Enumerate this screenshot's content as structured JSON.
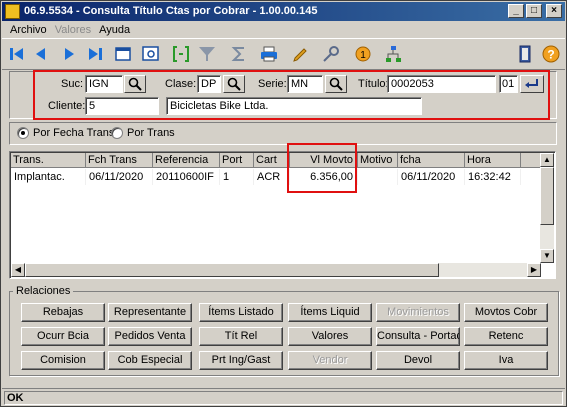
{
  "window": {
    "title": "06.9.5534 - Consulta Título Ctas por Cobrar - 1.00.00.145"
  },
  "menu": [
    {
      "label": "Archivo",
      "enabled": true
    },
    {
      "label": "Valores",
      "enabled": false
    },
    {
      "label": "Ayuda",
      "enabled": true
    }
  ],
  "toolbar": {
    "icons": [
      "first-icon",
      "prev-icon",
      "next-icon",
      "last-icon",
      "window-icon",
      "brackets-icon",
      "filter-icon",
      "sigma-icon",
      "print-icon",
      "pencil-icon",
      "key-icon",
      "alert-icon",
      "tree-icon",
      "exit-door-icon",
      "help-icon"
    ],
    "help_label": "?"
  },
  "search": {
    "suc_label": "Suc:",
    "suc_value": "IGN",
    "clase_label": "Clase:",
    "clase_value": "DP",
    "serie_label": "Serie:",
    "serie_value": "MN",
    "titulo_label": "Título:",
    "titulo_value": "0002053",
    "cuota_value": "01",
    "cliente_label": "Cliente:",
    "cliente_value": "5",
    "cliente_name": "Bicicletas Bike Ltda."
  },
  "view_mode": {
    "options": [
      "Por Fecha Trans",
      "Por Trans"
    ],
    "selected": "Por Fecha Trans"
  },
  "grid": {
    "columns": [
      "Trans.",
      "Fch Trans",
      "Referencia",
      "Port",
      "Cart",
      "Vl Movto",
      "Motivo",
      "fcha",
      "Hora"
    ],
    "rows": [
      [
        "Implantac.",
        "06/11/2020",
        "20110600IF",
        "1",
        "ACR",
        "6.356,00",
        "",
        "06/11/2020",
        "16:32:42"
      ]
    ]
  },
  "relaciones": {
    "title": "Relaciones",
    "buttons": [
      {
        "label": "Rebajas",
        "enabled": true
      },
      {
        "label": "Representante",
        "enabled": true
      },
      {
        "label": "Ítems Listado",
        "enabled": true
      },
      {
        "label": "Ítems Liquid",
        "enabled": true
      },
      {
        "label": "Movimientos",
        "enabled": false
      },
      {
        "label": "Movtos Cobr",
        "enabled": true
      },
      {
        "label": "Ocurr Bcia",
        "enabled": true
      },
      {
        "label": "Pedidos Venta",
        "enabled": true
      },
      {
        "label": "Tít Rel",
        "enabled": true
      },
      {
        "label": "Valores",
        "enabled": true
      },
      {
        "label": "Consulta - Portado",
        "enabled": true
      },
      {
        "label": "Retenc",
        "enabled": true
      },
      {
        "label": "Comision",
        "enabled": true
      },
      {
        "label": "Cob Especial",
        "enabled": true
      },
      {
        "label": "Prt Ing/Gast",
        "enabled": true
      },
      {
        "label": "Vendor",
        "enabled": false
      },
      {
        "label": "Devol",
        "enabled": true
      },
      {
        "label": "Iva",
        "enabled": true
      }
    ]
  },
  "status": {
    "text": "OK"
  },
  "colors": {
    "title_bar": "#0a246a",
    "highlight": "#e01010",
    "face": "#d4d0c8"
  }
}
